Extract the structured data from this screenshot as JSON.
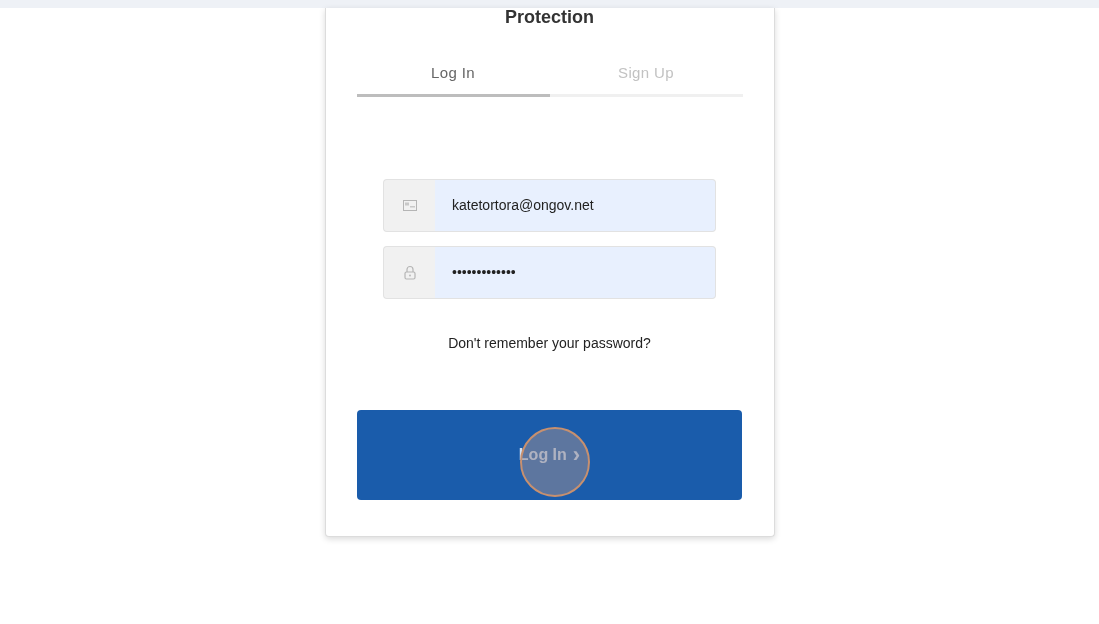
{
  "card_title": "Protection",
  "tabs": [
    {
      "label": "Log In",
      "selected": true
    },
    {
      "label": "Sign Up",
      "selected": false
    }
  ],
  "fields": [
    {
      "kind": "email",
      "value": "katetortora@ongov.net"
    },
    {
      "kind": "password",
      "value": "•••••••••••••"
    }
  ],
  "forgot_link": "Don't remember your password?",
  "submit": {
    "label": "Log In",
    "arrow": "›"
  }
}
